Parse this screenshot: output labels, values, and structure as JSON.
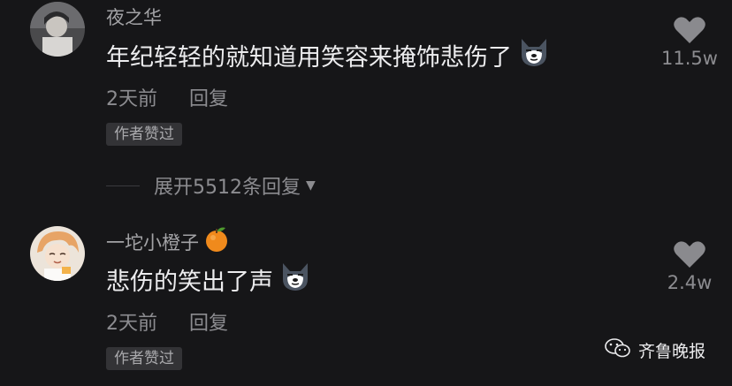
{
  "comments": [
    {
      "username": "夜之华",
      "text": "年纪轻轻的就知道用笑容来掩饰悲伤了",
      "time": "2天前",
      "reply_label": "回复",
      "badge": "作者赞过",
      "like_count": "11.5w",
      "emoji": "wolf-face-emoji"
    },
    {
      "username": "一坨小橙子",
      "username_emoji": "orange-emoji",
      "text": "悲伤的笑出了声",
      "time": "2天前",
      "reply_label": "回复",
      "badge": "作者赞过",
      "like_count": "2.4w",
      "emoji": "wolf-face-emoji"
    }
  ],
  "expand_replies": {
    "label": "展开5512条回复"
  },
  "watermark": {
    "text": "齐鲁晚报"
  },
  "colors": {
    "background": "#161618",
    "heart": "#8a8a8e",
    "orange": "#f08a1c"
  }
}
